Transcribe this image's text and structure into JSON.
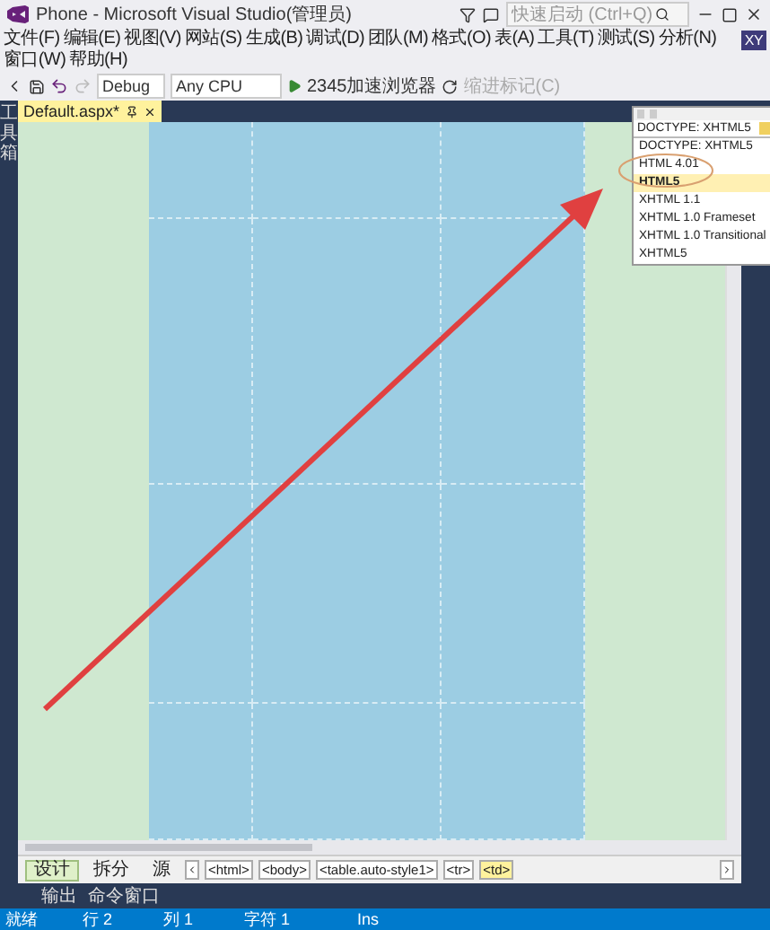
{
  "window": {
    "title": "Phone - Microsoft Visual Studio(管理员)",
    "quick_launch": {
      "placeholder": "快速启动 (Ctrl+Q)"
    },
    "user_badge": "XY"
  },
  "menu_rows": [
    [
      "文件(F)",
      "编辑(E)",
      "视图(V)",
      "网站(S)",
      "生成(B)",
      "调试(D)",
      "团队(M)",
      "格式(O)",
      "表(A)",
      "工具(T)",
      "测试(S)",
      "分析(N)"
    ],
    [
      "窗口(W)",
      "帮助(H)"
    ]
  ],
  "toolbar": {
    "configuration": "Debug",
    "platform": "Any CPU",
    "browser": "2345加速浏览器",
    "disabled_command": "缩进标记(C)"
  },
  "toolbox_strip": "工具箱",
  "document_tabs": [
    {
      "label": "Default.aspx*",
      "selected": true
    }
  ],
  "doctype_dropdown": {
    "value": "DOCTYPE: XHTML5",
    "options": [
      {
        "label": "DOCTYPE: XHTML5",
        "highlighted": false
      },
      {
        "label": "HTML 4.01",
        "highlighted": false
      },
      {
        "label": "HTML5",
        "highlighted": true
      },
      {
        "label": "XHTML 1.1",
        "highlighted": false
      },
      {
        "label": "XHTML 1.0 Frameset",
        "highlighted": false
      },
      {
        "label": "XHTML 1.0 Transitional",
        "highlighted": false
      },
      {
        "label": "XHTML5",
        "highlighted": false
      }
    ]
  },
  "view_tabs": [
    {
      "label": "设计",
      "selected": true
    },
    {
      "label": "拆分",
      "selected": false
    },
    {
      "label": "源",
      "selected": false
    }
  ],
  "tag_path": [
    {
      "label": "<html>",
      "selected": false
    },
    {
      "label": "<body>",
      "selected": false
    },
    {
      "label": "<table.auto-style1>",
      "selected": false
    },
    {
      "label": "<tr>",
      "selected": false
    },
    {
      "label": "<td>",
      "selected": true
    }
  ],
  "output_tabs": [
    "输出",
    "命令窗口"
  ],
  "status_bar": [
    "就绪",
    "行 2",
    "列 1",
    "字符 1",
    "Ins"
  ]
}
